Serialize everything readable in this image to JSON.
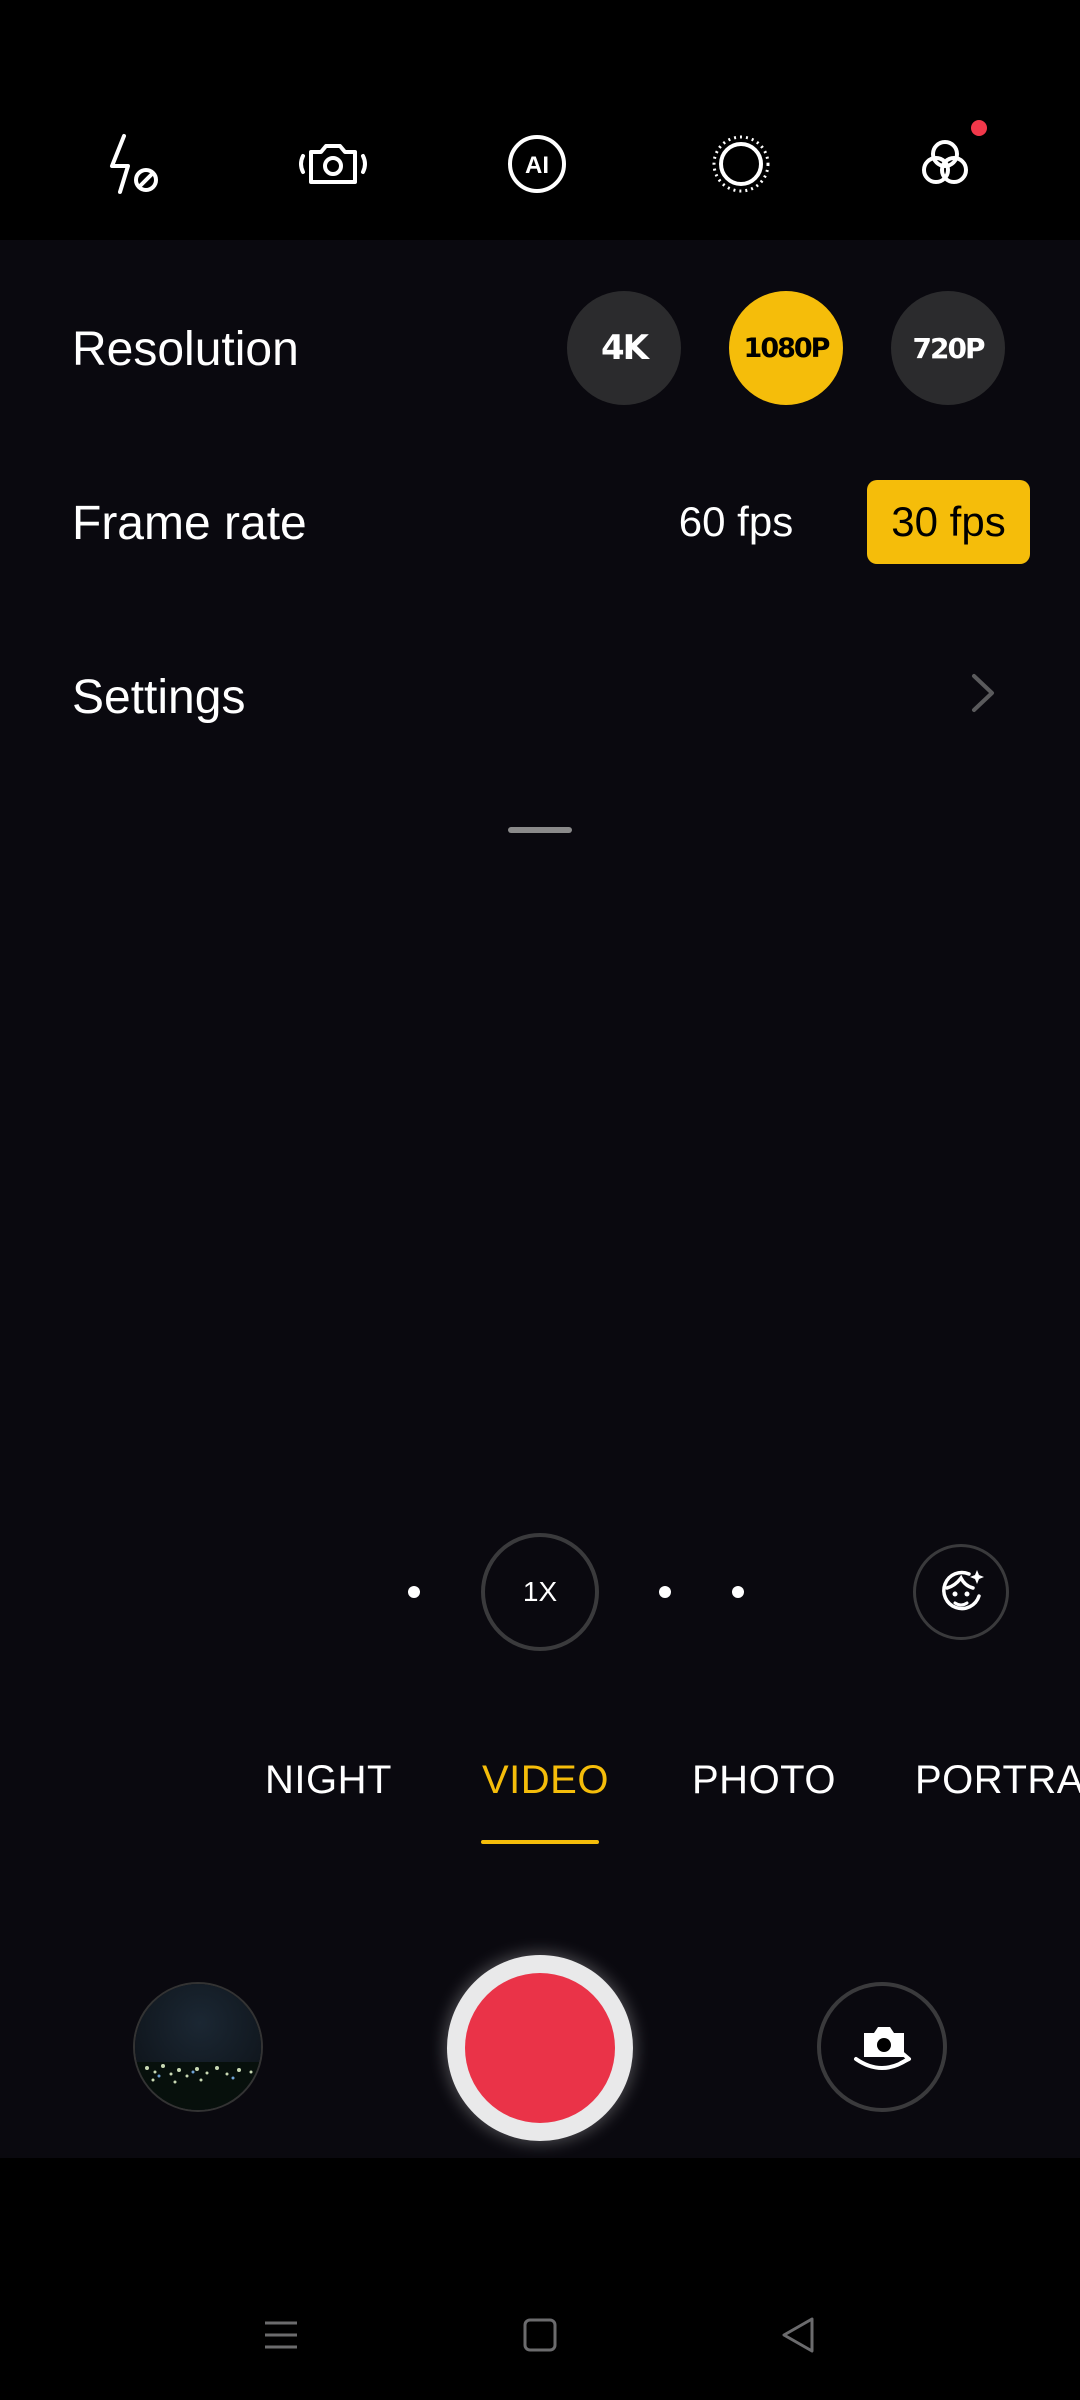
{
  "toolbar": {
    "items": [
      {
        "name": "flash-off-icon"
      },
      {
        "name": "camera-stabilization-icon"
      },
      {
        "name": "ai-icon",
        "label": "AI"
      },
      {
        "name": "dotted-circle-icon"
      },
      {
        "name": "filters-icon",
        "has_notification": true
      }
    ]
  },
  "panel": {
    "resolution": {
      "label": "Resolution",
      "options": [
        "4K",
        "1080P",
        "720P"
      ],
      "selected": "1080P"
    },
    "frame_rate": {
      "label": "Frame rate",
      "options": [
        "60 fps",
        "30 fps"
      ],
      "selected": "30 fps"
    },
    "settings": {
      "label": "Settings"
    }
  },
  "zoom": {
    "value": "1X"
  },
  "modes": {
    "items": [
      "NIGHT",
      "VIDEO",
      "PHOTO",
      "PORTRAI"
    ],
    "active": "VIDEO"
  },
  "colors": {
    "accent": "#f5bd0a",
    "record": "#ea3348",
    "background": "#0a090f",
    "notification": "#f2384a"
  }
}
